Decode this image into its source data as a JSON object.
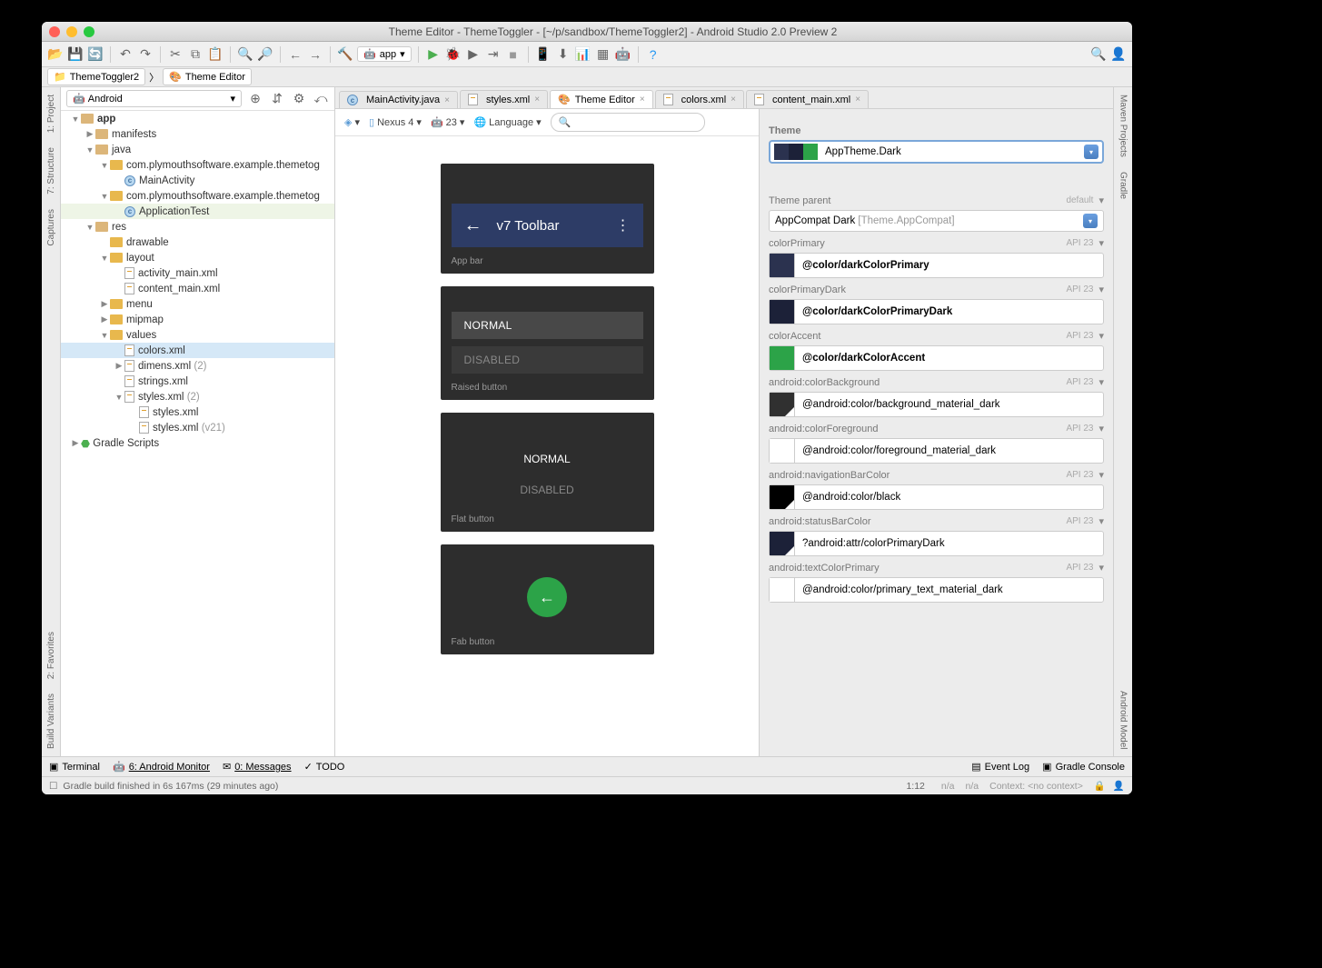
{
  "title": "Theme Editor - ThemeToggler - [~/p/sandbox/ThemeToggler2] - Android Studio 2.0 Preview 2",
  "breadcrumb": {
    "project": "ThemeToggler2",
    "tab": "Theme Editor"
  },
  "toolbar": {
    "app": "app"
  },
  "sidebar": {
    "mode": "Android",
    "tree": {
      "app": "app",
      "manifests": "manifests",
      "java": "java",
      "pkg1": "com.plymouthsoftware.example.themetog",
      "main_activity": "MainActivity",
      "pkg2": "com.plymouthsoftware.example.themetog",
      "app_test": "ApplicationTest",
      "res": "res",
      "drawable": "drawable",
      "layout": "layout",
      "activity_main": "activity_main.xml",
      "content_main": "content_main.xml",
      "menu": "menu",
      "mipmap": "mipmap",
      "values": "values",
      "colors": "colors.xml",
      "dimens": "dimens.xml",
      "dimens_count": "(2)",
      "strings": "strings.xml",
      "styles": "styles.xml",
      "styles_count": "(2)",
      "styles1": "styles.xml",
      "styles2": "styles.xml",
      "styles2_suffix": "(v21)",
      "gradle": "Gradle Scripts"
    }
  },
  "editor_tabs": [
    {
      "label": "MainActivity.java"
    },
    {
      "label": "styles.xml"
    },
    {
      "label": "Theme Editor",
      "active": true
    },
    {
      "label": "colors.xml"
    },
    {
      "label": "content_main.xml"
    }
  ],
  "preview_bar": {
    "device": "Nexus 4",
    "sdk": "23",
    "lang": "Language",
    "search_placeholder": ""
  },
  "preview": {
    "toolbar_title": "v7 Toolbar",
    "appbar_label": "App bar",
    "raised_normal": "NORMAL",
    "raised_disabled": "DISABLED",
    "raised_label": "Raised button",
    "flat_normal": "NORMAL",
    "flat_disabled": "DISABLED",
    "flat_label": "Flat button",
    "fab_label": "Fab button"
  },
  "theme": {
    "heading": "Theme",
    "name": "AppTheme.Dark",
    "swatches": [
      "#2b324f",
      "#1c2138",
      "#2ca348"
    ],
    "parent_heading": "Theme parent",
    "parent_default": "default",
    "parent_name": "AppCompat Dark",
    "parent_suffix": "[Theme.AppCompat]",
    "attrs": [
      {
        "label": "colorPrimary",
        "api": "API 23",
        "value": "@color/darkColorPrimary",
        "chip": "#2b324f",
        "bold": true,
        "tri": false
      },
      {
        "label": "colorPrimaryDark",
        "api": "API 23",
        "value": "@color/darkColorPrimaryDark",
        "chip": "#1c2138",
        "bold": true,
        "tri": false
      },
      {
        "label": "colorAccent",
        "api": "API 23",
        "value": "@color/darkColorAccent",
        "chip": "#2ca348",
        "bold": true,
        "tri": false
      },
      {
        "label": "android:colorBackground",
        "api": "API 23",
        "value": "@android:color/background_material_dark",
        "chip": "#303030",
        "bold": false,
        "tri": true
      },
      {
        "label": "android:colorForeground",
        "api": "API 23",
        "value": "@android:color/foreground_material_dark",
        "chip": "#ffffff",
        "bold": false,
        "tri": true
      },
      {
        "label": "android:navigationBarColor",
        "api": "API 23",
        "value": "@android:color/black",
        "chip": "#000000",
        "bold": false,
        "tri": true
      },
      {
        "label": "android:statusBarColor",
        "api": "API 23",
        "value": "?android:attr/colorPrimaryDark",
        "chip": "#1c2138",
        "bold": false,
        "tri": true
      },
      {
        "label": "android:textColorPrimary",
        "api": "API 23",
        "value": "@android:color/primary_text_material_dark",
        "chip": "#ffffff",
        "bold": false,
        "tri": false
      }
    ]
  },
  "left_tools": [
    "1: Project",
    "7: Structure",
    "Captures",
    "2: Favorites",
    "Build Variants"
  ],
  "right_tools": [
    "Maven Projects",
    "Gradle",
    "Android Model"
  ],
  "bottom_tools": {
    "terminal": "Terminal",
    "monitor": "6: Android Monitor",
    "messages": "0: Messages",
    "todo": "TODO",
    "eventlog": "Event Log",
    "gradle_console": "Gradle Console"
  },
  "status": {
    "msg": "Gradle build finished in 6s 167ms (29 minutes ago)",
    "pos": "1:12",
    "na1": "n/a",
    "na2": "n/a",
    "ctx": "Context: <no context>"
  }
}
